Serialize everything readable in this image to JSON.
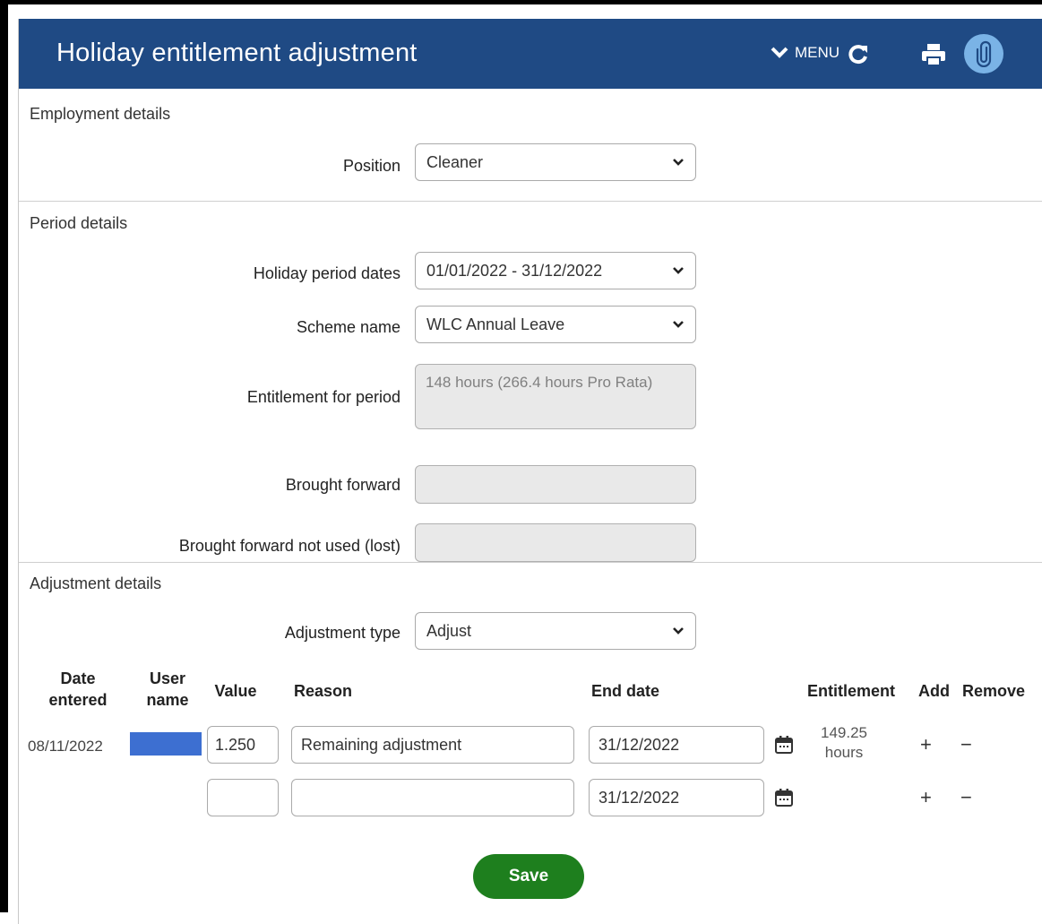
{
  "header": {
    "title": "Holiday entitlement adjustment",
    "menu_label": "MENU",
    "bg_color": "#1f4a84"
  },
  "employment": {
    "section_title": "Employment details",
    "position_label": "Position",
    "position_value": "Cleaner"
  },
  "period": {
    "section_title": "Period details",
    "holiday_dates_label": "Holiday period dates",
    "holiday_dates_value": "01/01/2022 - 31/12/2022",
    "scheme_label": "Scheme name",
    "scheme_value": "WLC Annual Leave",
    "entitlement_label": "Entitlement for period",
    "entitlement_value": "148 hours (266.4 hours Pro Rata)",
    "brought_forward_label": "Brought forward",
    "brought_forward_value": "",
    "bf_lost_label": "Brought forward not used (lost)",
    "bf_lost_value": ""
  },
  "adjustment": {
    "section_title": "Adjustment details",
    "type_label": "Adjustment type",
    "type_value": "Adjust",
    "columns": {
      "date_entered_1": "Date",
      "date_entered_2": "entered",
      "user_name_1": "User",
      "user_name_2": "name",
      "value": "Value",
      "reason": "Reason",
      "end_date": "End date",
      "entitlement": "Entitlement",
      "add": "Add",
      "remove": "Remove"
    },
    "rows": [
      {
        "date_entered": "08/11/2022",
        "value": "1.250",
        "reason": "Remaining adjustment",
        "end_date": "31/12/2022",
        "entitlement_1": "149.25",
        "entitlement_2": "hours",
        "add": "+",
        "remove": "−"
      },
      {
        "date_entered": "",
        "value": "",
        "reason": "",
        "end_date": "31/12/2022",
        "entitlement_1": "",
        "entitlement_2": "",
        "add": "+",
        "remove": "−"
      }
    ]
  },
  "save_label": "Save",
  "colors": {
    "save": "#1e7f1e",
    "clip_circle": "#7ab3e6",
    "redaction": "#3d6fd1"
  },
  "icons": [
    "chevron-down-icon",
    "refresh-icon",
    "print-icon",
    "paperclip-icon",
    "calendar-icon",
    "caret-down-icon"
  ]
}
